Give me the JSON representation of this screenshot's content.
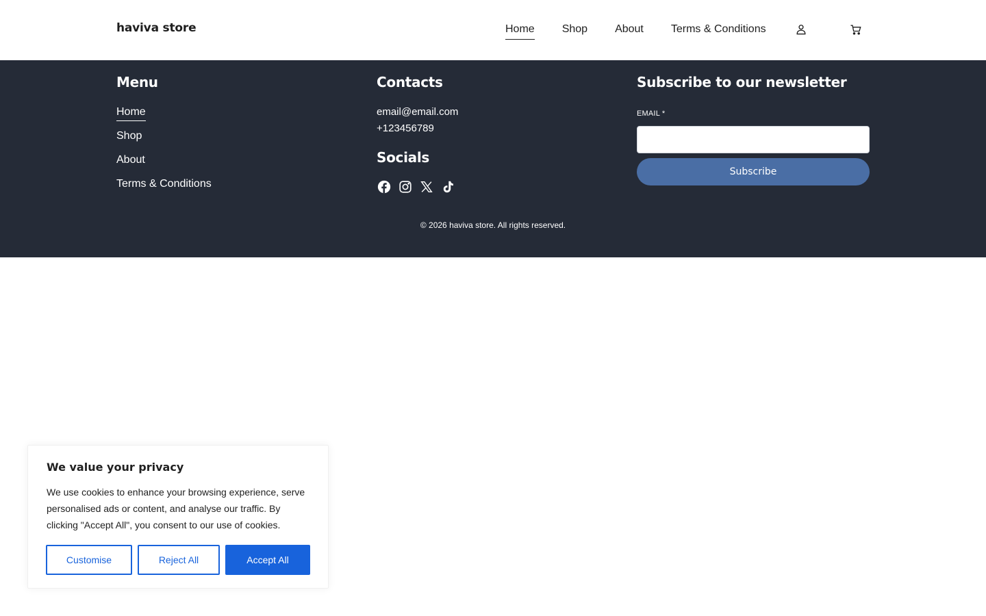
{
  "header": {
    "brand": "haviva store",
    "nav": [
      {
        "label": "Home",
        "active": true
      },
      {
        "label": "Shop",
        "active": false
      },
      {
        "label": "About",
        "active": false
      },
      {
        "label": "Terms & Conditions",
        "active": false
      }
    ],
    "icons": [
      "account-icon",
      "cart-icon"
    ]
  },
  "footer": {
    "menu_title": "Menu",
    "menu": [
      {
        "label": "Home",
        "active": true
      },
      {
        "label": "Shop",
        "active": false
      },
      {
        "label": "About",
        "active": false
      },
      {
        "label": "Terms & Conditions",
        "active": false
      }
    ],
    "contacts_title": "Contacts",
    "email": "email@email.com",
    "phone": "+123456789",
    "socials_title": "Socials",
    "socials": [
      "facebook-icon",
      "instagram-icon",
      "x-icon",
      "tiktok-icon"
    ],
    "newsletter_title": "Subscribe to our newsletter",
    "email_label": "EMAIL *",
    "email_value": "",
    "subscribe_label": "Subscribe",
    "copyright": "© 2026 haviva store. All rights reserved."
  },
  "cookie": {
    "title": "We value your privacy",
    "text": "We use cookies to enhance your browsing experience, serve personalised ads or content, and analyse our traffic. By clicking \"Accept All\", you consent to our use of cookies.",
    "customise": "Customise",
    "reject": "Reject All",
    "accept": "Accept All"
  },
  "colors": {
    "footer_bg": "#252b37",
    "subscribe_button": "#4a6ea5",
    "cookie_accent": "#1863dc"
  }
}
